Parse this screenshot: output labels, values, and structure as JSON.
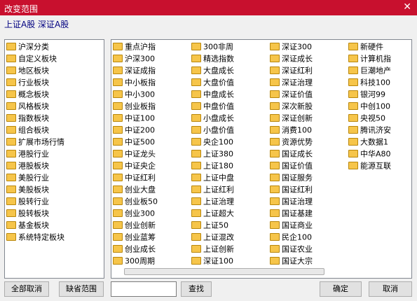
{
  "window": {
    "title": "改变范围",
    "close_glyph": "✕"
  },
  "scope_text": "上证A股  深证A股",
  "left_list": [
    "沪深分类",
    "自定义板块",
    "地区板块",
    "行业板块",
    "概念板块",
    "风格板块",
    "指数板块",
    "组合板块",
    "扩展市场行情",
    "港股行业",
    "港股板块",
    "美股行业",
    "美股板块",
    "股转行业",
    "股转板块",
    "基金板块",
    "系统特定板块"
  ],
  "right_columns": [
    [
      "重点沪指",
      "沪深300",
      "深证成指",
      "中小板指",
      "中小300",
      "创业板指",
      "中证100",
      "中证200",
      "中证500",
      "中证龙头",
      "中证央企",
      "中证红利",
      "创业大盘",
      "创业板50",
      "创业300",
      "创业创新",
      "创业蓝筹",
      "创业成长",
      "300周期"
    ],
    [
      "300非周",
      "精选指数",
      "大盘成长",
      "大盘价值",
      "中盘成长",
      "中盘价值",
      "小盘成长",
      "小盘价值",
      "央企100",
      "上证380",
      "上证180",
      "上证中盘",
      "上证红利",
      "上证治理",
      "上证超大",
      "上证50",
      "上证混改",
      "上证创新",
      "深证100"
    ],
    [
      "深证300",
      "深证成长",
      "深证红利",
      "深证治理",
      "深证价值",
      "深次新股",
      "深证创新",
      "消费100",
      "资源优势",
      "国证成长",
      "国证价值",
      "国证服务",
      "国证红利",
      "国证治理",
      "国证基建",
      "国证商业",
      "民企100",
      "国证农业",
      "国证大宗"
    ],
    [
      "新硬件",
      "计算机指",
      "巨潮地产",
      "科技100",
      "银河99",
      "中创100",
      "央视50",
      "腾讯济安",
      "大数据1",
      "中华A80",
      "能源互联"
    ]
  ],
  "buttons": {
    "clear_all": "全部取消",
    "default_scope": "缺省范围",
    "search": "查找",
    "ok": "确定",
    "cancel": "取消"
  },
  "search": {
    "value": ""
  },
  "colors": {
    "titlebar": "#c8102e",
    "folder": "#f6c54a",
    "scope_text": "#000080"
  }
}
